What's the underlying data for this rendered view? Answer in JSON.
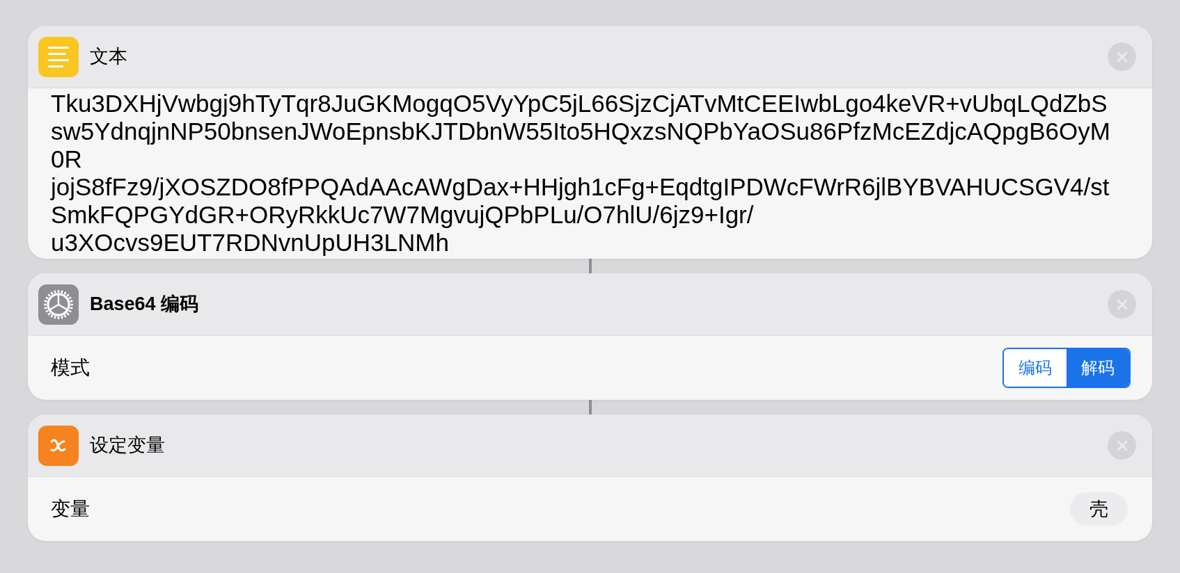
{
  "actions": [
    {
      "kind": "text",
      "title": "文本",
      "lines": [
        "Tku3DXHjVwbgj9hTyTqr8JuGKMogqO5VyYpC5jL66SjzCjATvMtCEEIwbLgo4keVR+vUbqLQdZbS",
        "sw5YdnqjnNP50bnsenJWoEpnsbKJTDbnW55Ito5HQxzsNQPbYaOSu86PfzMcEZdjcAQpgB6OyM",
        "0R",
        "jojS8fFz9/jXOSZDO8fPPQAdAAcAWgDax+HHjgh1cFg+EqdtgIPDWcFWrR6jlBYBVAHUCSGV4/st",
        "SmkFQPGYdGR+ORyRkkUc7W7MgvujQPbPLu/O7hlU/6jz9+Igr/",
        "u3XOcvs9EUT7RDNvnUpUH3LNMh"
      ]
    },
    {
      "kind": "base64",
      "title": "Base64 编码",
      "param": {
        "label": "模式",
        "options": [
          {
            "label": "编码",
            "selected": false
          },
          {
            "label": "解码",
            "selected": true
          }
        ]
      }
    },
    {
      "kind": "variable",
      "title": "设定变量",
      "param": {
        "label": "变量",
        "value": "壳"
      }
    }
  ]
}
